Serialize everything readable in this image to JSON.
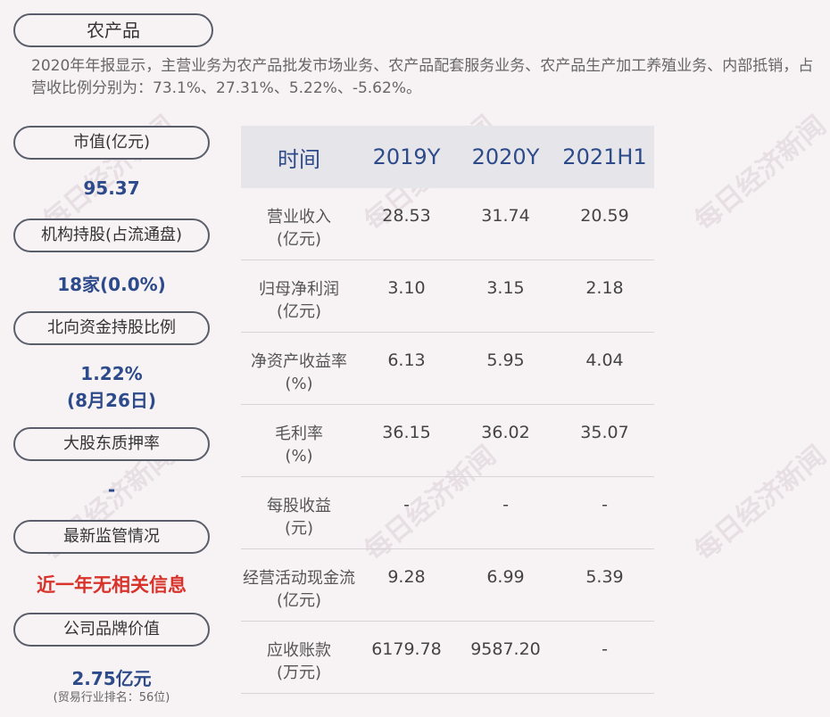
{
  "title": "农产品",
  "description": "2020年年报显示，主营业务为农产品批发市场业务、农产品配套服务业务、农产品生产加工养殖业务、内部抵销，占营收比例分别为：73.1%、27.31%、5.22%、-5.62%。",
  "left": {
    "market_cap": {
      "label": "市值(亿元)",
      "value": "95.37"
    },
    "institution": {
      "label": "机构持股(占流通盘)",
      "value": "18家(0.0%)"
    },
    "northbound": {
      "label": "北向资金持股比例",
      "value": "1.22%",
      "date": "(8月26日)"
    },
    "pledge": {
      "label": "大股东质押率",
      "value": "-"
    },
    "regulation": {
      "label": "最新监管情况",
      "value": "近一年无相关信息"
    },
    "brand": {
      "label": "公司品牌价值",
      "value": "2.75亿元",
      "note": "(贸易行业排名：56位)"
    }
  },
  "table": {
    "headers": [
      "时间",
      "2019Y",
      "2020Y",
      "2021H1"
    ],
    "rows": [
      {
        "label1": "营业收入",
        "label2": "(亿元)",
        "values": [
          "28.53",
          "31.74",
          "20.59"
        ]
      },
      {
        "label1": "归母净利润",
        "label2": "(亿元)",
        "values": [
          "3.10",
          "3.15",
          "2.18"
        ]
      },
      {
        "label1": "净资产收益率",
        "label2": "(%)",
        "values": [
          "6.13",
          "5.95",
          "4.04"
        ]
      },
      {
        "label1": "毛利率",
        "label2": "(%)",
        "values": [
          "36.15",
          "36.02",
          "35.07"
        ]
      },
      {
        "label1": "每股收益",
        "label2": "(元)",
        "values": [
          "-",
          "-",
          "-"
        ]
      },
      {
        "label1": "经营活动现金流",
        "label2": "(亿元)",
        "values": [
          "9.28",
          "6.99",
          "5.39"
        ]
      },
      {
        "label1": "应收账款",
        "label2": "(万元)",
        "values": [
          "6179.78",
          "9587.20",
          "-"
        ]
      }
    ]
  },
  "watermark": "每日经济新闻"
}
